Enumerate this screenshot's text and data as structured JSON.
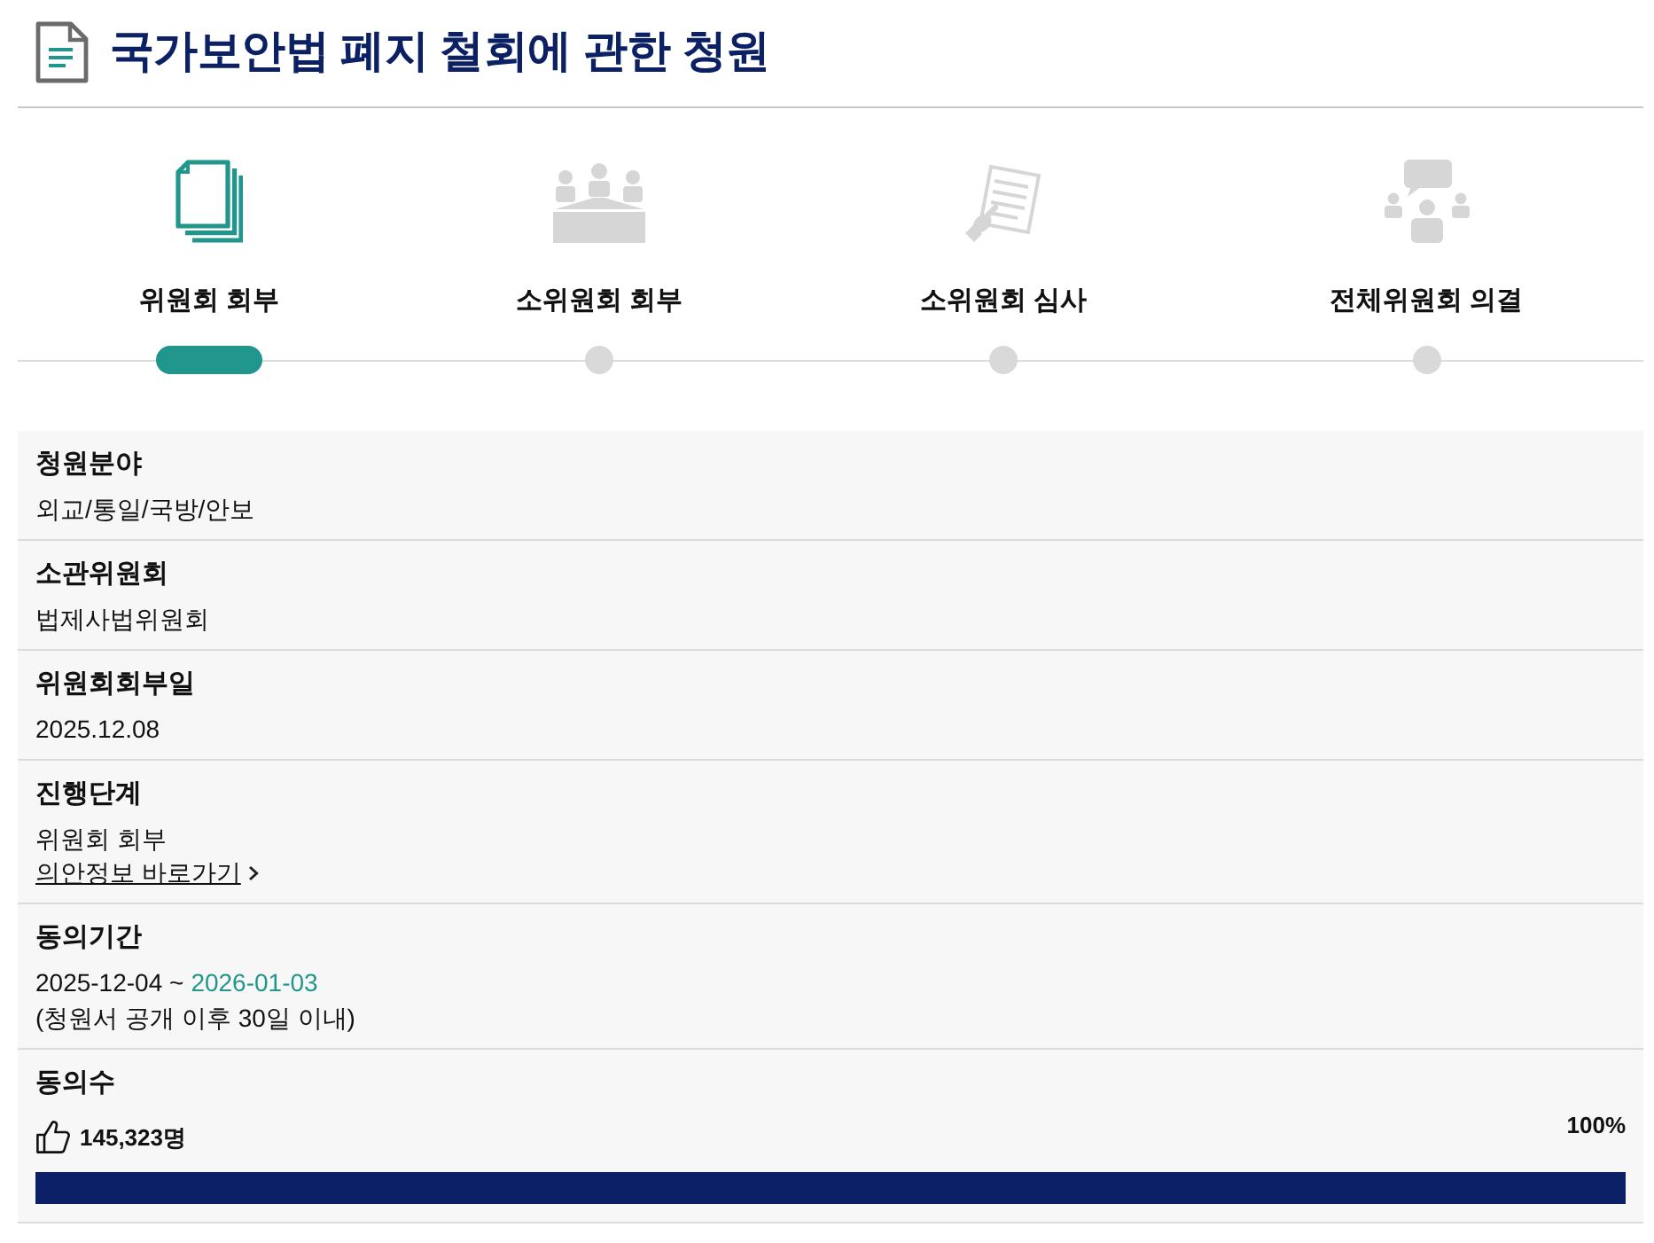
{
  "page": {
    "title": "국가보안법 폐지 철회에 관한 청원"
  },
  "steps": [
    {
      "kind": "documents",
      "label": "위원회 회부",
      "selected": true
    },
    {
      "kind": "meeting",
      "label": "소위원회 회부",
      "selected": false
    },
    {
      "kind": "review",
      "label": "소위원회 심사",
      "selected": false
    },
    {
      "kind": "discussion",
      "label": "전체위원회 의결",
      "selected": false
    }
  ],
  "details": [
    {
      "kind": "text",
      "label": "청원분야",
      "value": "외교/통일/국방/안보"
    },
    {
      "kind": "text",
      "label": "소관위원회",
      "value": "법제사법위원회"
    },
    {
      "kind": "text",
      "label": "위원회회부일",
      "value": "2025.12.08"
    },
    {
      "kind": "stage",
      "label": "진행단계",
      "value": "위원회 회부",
      "link": "의안정보 바로가기"
    },
    {
      "kind": "period",
      "label": "동의기간",
      "start": "2025-12-04 ~",
      "end": "2026-01-03",
      "note": "(청원서 공개 이후 30일 이내)"
    },
    {
      "kind": "count",
      "label": "동의수",
      "count": "145,323명",
      "percent": "100%",
      "level": 1
    }
  ]
}
